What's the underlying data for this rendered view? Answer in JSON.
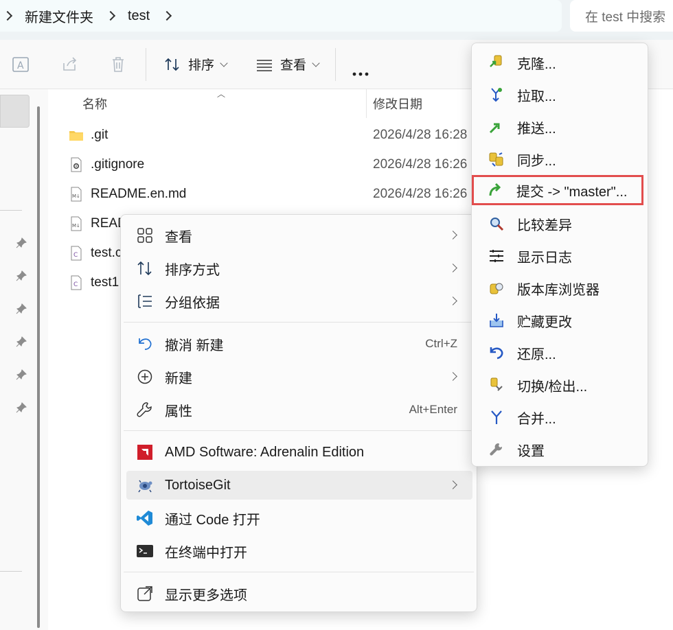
{
  "address": {
    "crumbs": [
      "新建文件夹",
      "test"
    ],
    "search_placeholder": "在 test 中搜索"
  },
  "toolbar": {
    "sort_label": "排序",
    "view_label": "查看",
    "more_label": "•••"
  },
  "filelist": {
    "col_name": "名称",
    "col_date": "修改日期",
    "files": [
      {
        "name": ".git",
        "date": "2026/4/28 16:28",
        "type": "folder"
      },
      {
        "name": ".gitignore",
        "date": "2026/4/28 16:26",
        "type": "config"
      },
      {
        "name": "README.en.md",
        "date": "2026/4/28 16:26",
        "type": "markdown"
      },
      {
        "name": "READ",
        "date": "",
        "type": "markdown"
      },
      {
        "name": "test.c",
        "date": "",
        "type": "c"
      },
      {
        "name": "test1",
        "date": "",
        "type": "c"
      }
    ]
  },
  "context_menu": {
    "view": "查看",
    "sort_by": "排序方式",
    "group_by": "分组依据",
    "undo_new": "撤消 新建",
    "undo_shortcut": "Ctrl+Z",
    "new": "新建",
    "properties": "属性",
    "properties_shortcut": "Alt+Enter",
    "amd": "AMD Software: Adrenalin Edition",
    "tortoisegit": "TortoiseGit",
    "open_code": "通过 Code 打开",
    "open_terminal": "在终端中打开",
    "show_more": "显示更多选项"
  },
  "submenu": {
    "clone": "克隆...",
    "pull": "拉取...",
    "push": "推送...",
    "sync": "同步...",
    "commit": "提交 -> \"master\"...",
    "diff": "比较差异",
    "log": "显示日志",
    "repo_browser": "版本库浏览器",
    "stash": "贮藏更改",
    "revert": "还原...",
    "switch": "切换/检出...",
    "merge": "合并...",
    "settings": "设置"
  },
  "colors": {
    "highlight_border": "#e24d4d",
    "accent_blue": "#1f6fd1"
  }
}
